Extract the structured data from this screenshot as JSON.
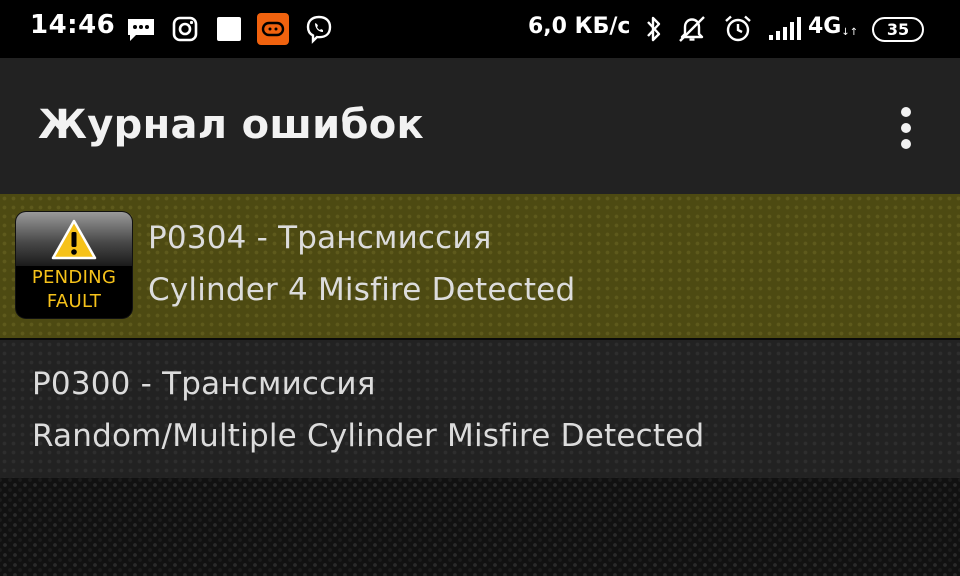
{
  "status_bar": {
    "time": "14:46",
    "network_speed": "6,0 КБ/с",
    "network_type": "4G",
    "network_type_sub": "↓↑",
    "battery_level": "35",
    "icons": [
      "message-icon",
      "instagram-icon",
      "square-icon",
      "app-notification-icon",
      "viber-icon",
      "bluetooth-icon",
      "silent-icon",
      "alarm-icon",
      "signal-icon"
    ]
  },
  "app_bar": {
    "title": "Журнал ошибок",
    "menu_icon": "more-vert-icon"
  },
  "faults": [
    {
      "code_line": "P0304 - Трансмиссия",
      "description": "Cylinder 4 Misfire Detected",
      "badge": {
        "line1": "PENDING",
        "line2": "FAULT",
        "icon": "warning-icon"
      },
      "highlight_color": "#4d4a12"
    },
    {
      "code_line": "P0300 - Трансмиссия",
      "description": "Random/Multiple Cylinder Misfire Detected"
    }
  ],
  "colors": {
    "app_bar_bg": "#222222",
    "status_bar_bg": "#000000",
    "badge_text": "#f6c21a",
    "text": "#dcdcdc"
  }
}
